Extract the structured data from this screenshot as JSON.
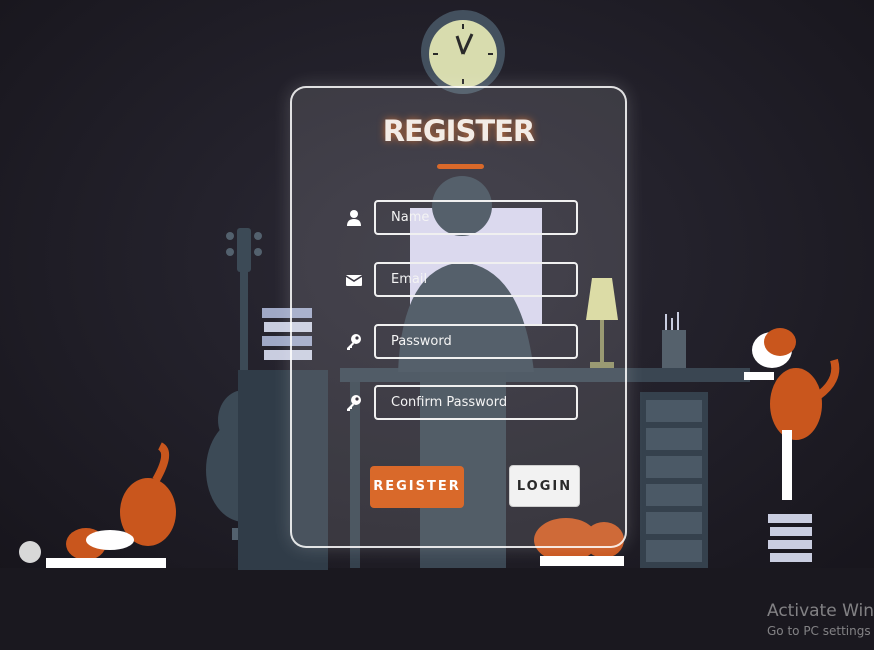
{
  "form": {
    "title": "REGISTER",
    "fields": [
      {
        "icon": "user-icon",
        "placeholder": "Name",
        "value": ""
      },
      {
        "icon": "envelope-icon",
        "placeholder": "Email",
        "value": ""
      },
      {
        "icon": "key-icon",
        "placeholder": "Password",
        "value": ""
      },
      {
        "icon": "key-icon",
        "placeholder": "Confirm Password",
        "value": ""
      }
    ],
    "register_label": "REGISTER",
    "login_label": "LOGIN"
  },
  "watermark": {
    "line1": "Activate Windows",
    "line2": "Go to PC settings to activate Windows."
  },
  "colors": {
    "accent": "#d9692a",
    "background": "#1f1c25",
    "card_border": "#ffffff"
  }
}
